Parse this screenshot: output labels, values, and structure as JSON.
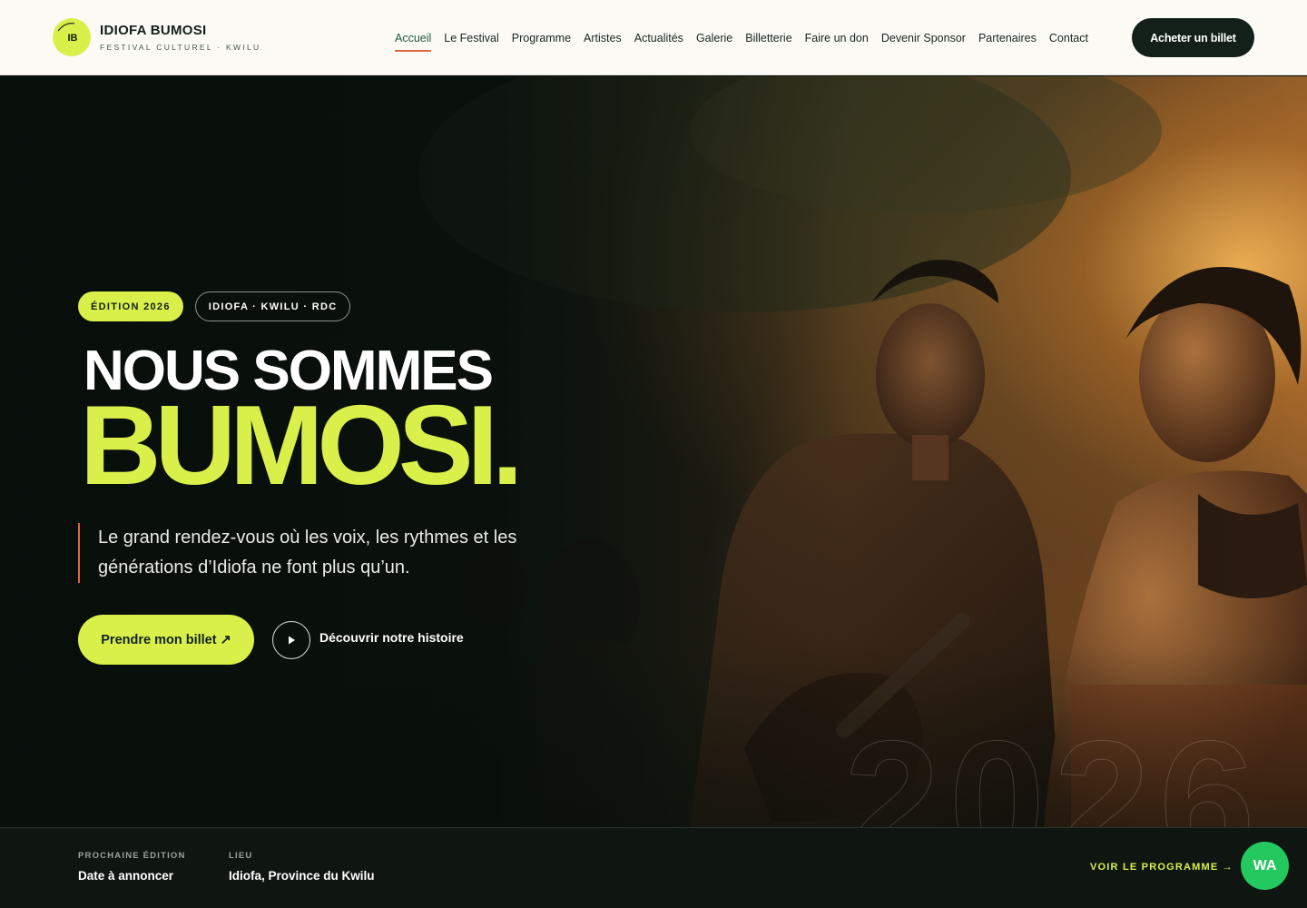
{
  "brand": {
    "logo_text": "IB",
    "name": "IDIOFA BUMOSI",
    "subtitle": "FESTIVAL CULTUREL · KWILU"
  },
  "nav": {
    "items": [
      {
        "label": "Accueil",
        "active": true
      },
      {
        "label": "Le Festival"
      },
      {
        "label": "Programme"
      },
      {
        "label": "Artistes"
      },
      {
        "label": "Actualités"
      },
      {
        "label": "Galerie"
      },
      {
        "label": "Billetterie"
      },
      {
        "label": "Faire un don"
      },
      {
        "label": "Devenir Sponsor"
      },
      {
        "label": "Partenaires"
      },
      {
        "label": "Contact"
      }
    ],
    "cta_label": "Acheter un billet"
  },
  "hero": {
    "badge_edition": "ÉDITION 2026",
    "badge_location": "IDIOFA · KWILU · RDC",
    "title_line1": "NOUS SOMMES",
    "title_line2": "BUMOSI.",
    "tagline": "Le grand rendez-vous où les voix, les rythmes et les générations d’Idiofa ne font plus qu’un.",
    "primary_button": "Prendre mon billet ↗",
    "secondary_button": "Découvrir notre histoire",
    "watermark": "2026"
  },
  "infobar": {
    "next_edition_label": "PROCHAINE ÉDITION",
    "next_edition_value": "Date à annoncer",
    "venue_label": "LIEU",
    "venue_value": "Idiofa, Province du Kwilu",
    "program_link": "VOIR LE PROGRAMME →",
    "whatsapp_label": "WA"
  },
  "colors": {
    "accent_lime": "#d9f04a",
    "accent_orange": "#e0673f",
    "dark": "#13201a",
    "whatsapp_green": "#23c85f"
  }
}
